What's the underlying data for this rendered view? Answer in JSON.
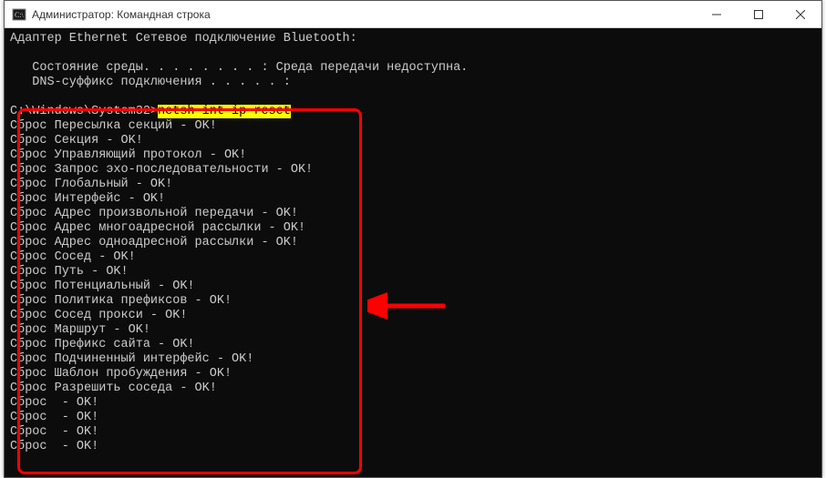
{
  "window": {
    "title": "Администратор: Командная строка"
  },
  "terminal": {
    "preamble": [
      "Адаптер Ethernet Сетевое подключение Bluetooth:",
      "",
      "   Состояние среды. . . . . . . . : Среда передачи недоступна.",
      "   DNS-суффикс подключения . . . . . :",
      ""
    ],
    "prompt": "C:\\Windows\\System32>",
    "command": "netsh int ip reset",
    "output": [
      "Сброс Пересылка секций - OK!",
      "Сброс Секция - OK!",
      "Сброс Управляющий протокол - OK!",
      "Сброс Запрос эхо-последовательности - OK!",
      "Сброс Глобальный - OK!",
      "Сброс Интерфейс - OK!",
      "Сброс Адрес произвольной передачи - OK!",
      "Сброс Адрес многоадресной рассылки - OK!",
      "Сброс Адрес одноадресной рассылки - OK!",
      "Сброс Сосед - OK!",
      "Сброс Путь - OK!",
      "Сброс Потенциальный - OK!",
      "Сброс Политика префиксов - OK!",
      "Сброс Сосед прокси - OK!",
      "Сброс Маршрут - OK!",
      "Сброс Префикс сайта - OK!",
      "Сброс Подчиненный интерфейс - OK!",
      "Сброс Шаблон пробуждения - OK!",
      "Сброс Разрешить соседа - OK!",
      "Сброс  - OK!",
      "Сброс  - OK!",
      "Сброс  - OK!",
      "Сброс  - OK!"
    ]
  }
}
